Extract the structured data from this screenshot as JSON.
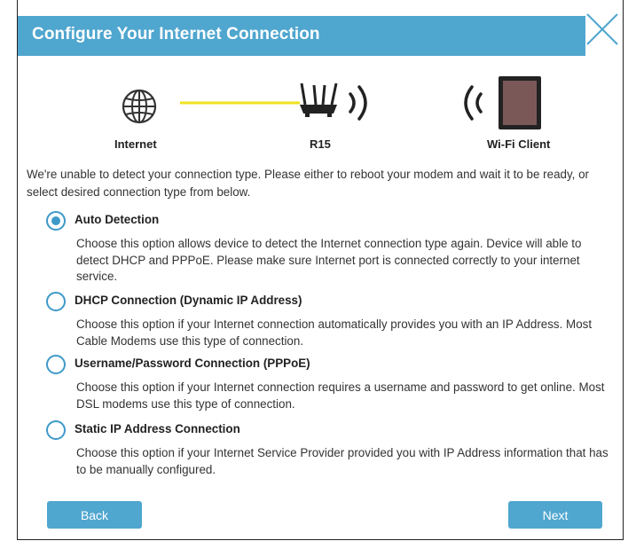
{
  "header": {
    "title": "Configure Your Internet Connection"
  },
  "topology": {
    "internet_label": "Internet",
    "router_label": "R15",
    "client_label": "Wi-Fi Client"
  },
  "intro_text": "We're unable to detect your connection type. Please either to reboot your modem and wait it to be ready, or select desired connection type from below.",
  "options": [
    {
      "title": "Auto Detection",
      "description": "Choose this option allows device to detect the Internet connection type again. Device will able to detect DHCP and PPPoE. Please make sure Internet port is connected correctly to your internet service.",
      "selected": true
    },
    {
      "title": "DHCP Connection (Dynamic IP Address)",
      "description": "Choose this option if your Internet connection automatically provides you with an IP Address. Most Cable Modems use this type of connection.",
      "selected": false
    },
    {
      "title": "Username/Password Connection (PPPoE)",
      "description": "Choose this option if your Internet connection requires a username and password to get online. Most DSL modems use this type of connection.",
      "selected": false
    },
    {
      "title": "Static IP Address Connection",
      "description": "Choose this option if your Internet Service Provider provided you with IP Address information that has to be manually configured.",
      "selected": false
    }
  ],
  "buttons": {
    "back": "Back",
    "next": "Next"
  },
  "colors": {
    "accent": "#4fa6cf",
    "radio": "#3e99c9",
    "link_line": "#f0e020"
  },
  "icons": {
    "internet": "globe-icon",
    "router": "router-icon",
    "signal": "wifi-signal-icon",
    "client": "tablet-icon",
    "close": "close-icon"
  }
}
